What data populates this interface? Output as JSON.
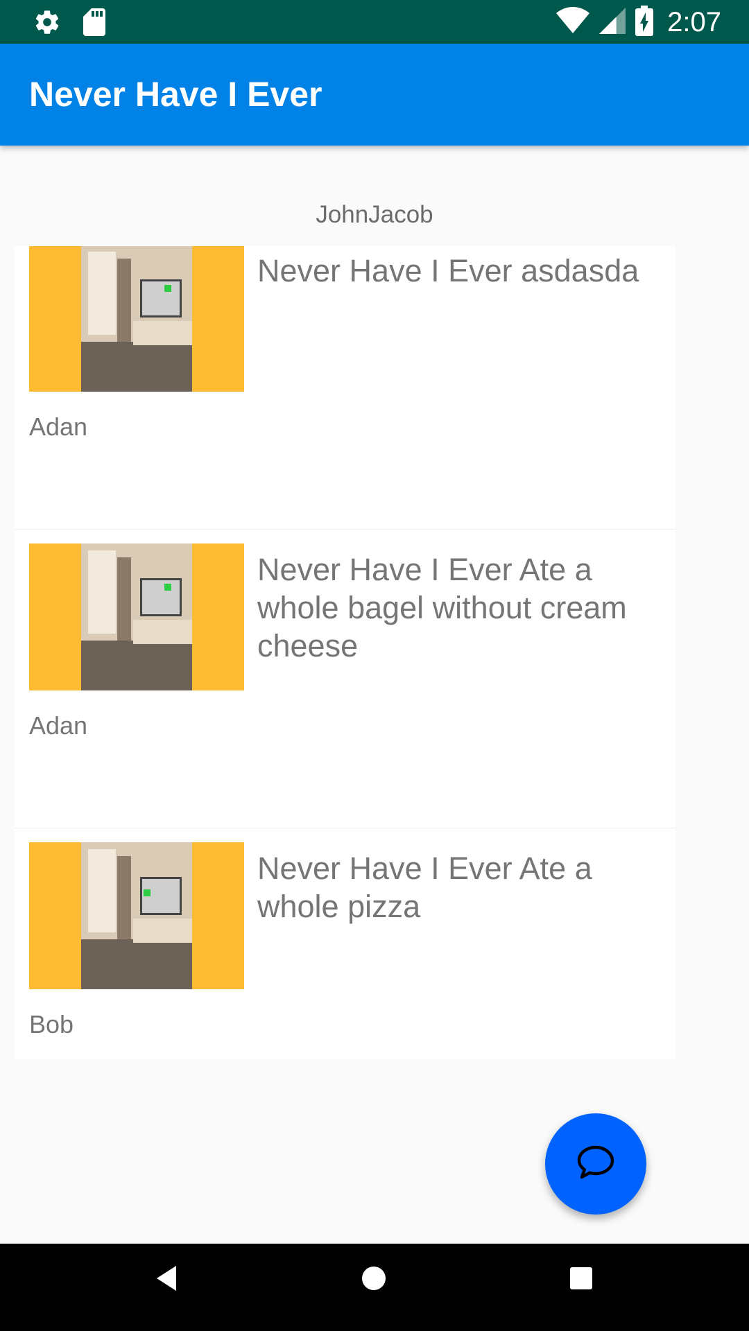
{
  "status_bar": {
    "time": "2:07",
    "left_icons": [
      "gear-icon",
      "sd-card-icon"
    ],
    "right_icons": [
      "wifi-icon",
      "signal-icon",
      "battery-charging-icon"
    ]
  },
  "app_bar": {
    "title": "Never Have I Ever"
  },
  "header": {
    "username": "JohnJacob"
  },
  "posts": [
    {
      "text": "Never Have I Ever asdasda",
      "author": "Adan"
    },
    {
      "text": "Never Have I Ever Ate a whole bagel without cream cheese",
      "author": "Adan"
    },
    {
      "text": "Never Have I Ever Ate a whole pizza",
      "author": "Bob"
    }
  ],
  "fab": {
    "icon": "chat-bubble-icon"
  },
  "nav_bar": {
    "icons": [
      "back-icon",
      "home-icon",
      "recents-icon"
    ]
  },
  "colors": {
    "status_bar": "#00574b",
    "app_bar": "#0082e6",
    "fab": "#0062ff",
    "thumb_bg": "#fdbb33",
    "text_gray": "#757575"
  }
}
